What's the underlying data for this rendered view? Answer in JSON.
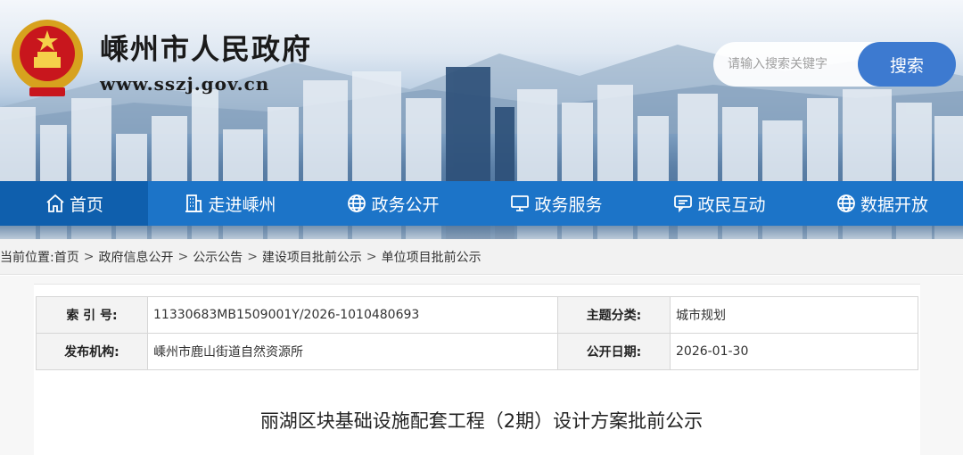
{
  "header": {
    "site_title": "嵊州市人民政府",
    "site_url": "www.sszj.gov.cn",
    "emblem_icon": "national-emblem-icon"
  },
  "search": {
    "placeholder": "请输入搜索关键字",
    "button_label": "搜索"
  },
  "nav": {
    "items": [
      {
        "label": "首页",
        "icon": "home-icon",
        "active": true
      },
      {
        "label": "走进嵊州",
        "icon": "building-icon",
        "active": false
      },
      {
        "label": "政务公开",
        "icon": "globe-icon",
        "active": false
      },
      {
        "label": "政务服务",
        "icon": "monitor-icon",
        "active": false
      },
      {
        "label": "政民互动",
        "icon": "chat-icon",
        "active": false
      },
      {
        "label": "数据开放",
        "icon": "globe-icon",
        "active": false
      }
    ]
  },
  "breadcrumb": {
    "prefix": "当前位置:",
    "items": [
      "首页",
      "政府信息公开",
      "公示公告",
      "建设项目批前公示",
      "单位项目批前公示"
    ],
    "separator": ">"
  },
  "info": {
    "index_label": "索 引 号:",
    "index_value": "11330683MB1509001Y/2026-1010480693",
    "category_label": "主题分类:",
    "category_value": "城市规划",
    "publisher_label": "发布机构:",
    "publisher_value": "嵊州市鹿山街道自然资源所",
    "date_label": "公开日期:",
    "date_value": "2026-01-30"
  },
  "article": {
    "title": "丽湖区块基础设施配套工程（2期）设计方案批前公示"
  },
  "colors": {
    "nav_bg": "#1c74c8",
    "nav_active": "#0f5fad",
    "search_button": "#3d7ad0"
  }
}
